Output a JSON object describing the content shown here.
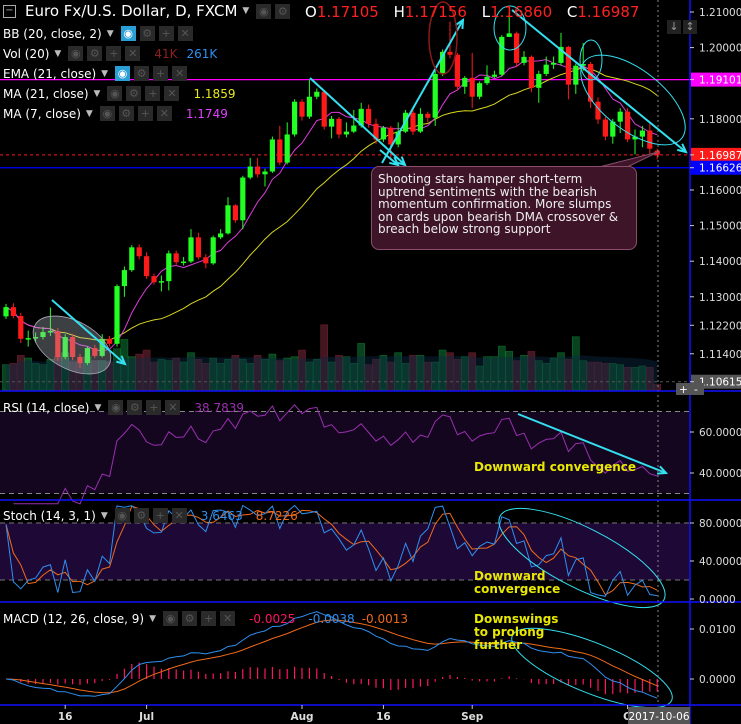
{
  "header": {
    "symbol_title": "Euro Fx/U.S. Dollar, D, FXCM",
    "collapse_icon": "minus-box-icon",
    "ohlc": {
      "o_label": "O",
      "o": "1.17105",
      "h_label": "H",
      "h": "1.17156",
      "l_label": "L",
      "l": "1.16860",
      "c_label": "C",
      "c": "1.16987"
    }
  },
  "legend_buttons": {
    "eye": "◉",
    "gear": "⚙",
    "plus": "+",
    "close": "✕",
    "dropdown": "▼"
  },
  "indicators": {
    "bb": {
      "label": "BB (20, close, 2)"
    },
    "vol": {
      "label": "Vol (20)",
      "value1": "41K",
      "value2": "261K"
    },
    "ema": {
      "label": "EMA (21, close)"
    },
    "ma21": {
      "label": "MA (21, close)",
      "value": "1.1859"
    },
    "ma7": {
      "label": "MA (7, close)",
      "value": "1.1749"
    },
    "rsi": {
      "label": "RSI (14, close)",
      "value": "38.7839"
    },
    "stoch": {
      "label": "Stoch (14, 3, 1)",
      "k": "3.6463",
      "d": "8.7226"
    },
    "macd": {
      "label": "MACD (12, 26, close, 9)",
      "hist": "-0.0025",
      "macd": "-0.0038",
      "signal": "-0.0013"
    }
  },
  "annotations": {
    "callout": "Shooting stars hamper short-term uptrend sentiments with the bearish momentum confirmation. More slumps on cards upon bearish DMA crossover & breach below strong support",
    "rsi_note": "Downward convergence",
    "stoch_note": "Downward convergence",
    "macd_note": "Downswings to prolong further"
  },
  "toolbar": {
    "scale_down": "↓",
    "scale_both": "↕",
    "zoom_in": "+",
    "zoom_out": "-"
  },
  "colors": {
    "up": "#22ff22",
    "down": "#ff1a1a",
    "ma7": "#e03be0",
    "ma21": "#d8d820",
    "rsi": "#9a2fb0",
    "stoch_k": "#2f8ff0",
    "stoch_d": "#f06a1c",
    "macd_hist": "#ff1464",
    "separator": "#1010ff",
    "drawing": "#33e0f0"
  },
  "chart_data": [
    {
      "type": "candlestick",
      "title": "Euro Fx/U.S. Dollar, D, FXCM",
      "open": [
        1.1245,
        1.1271,
        1.1246,
        1.1182,
        1.1184,
        1.1187,
        1.1201,
        1.1204,
        1.1131,
        1.1187,
        1.1131,
        1.1114,
        1.1156,
        1.1134,
        1.1182,
        1.1168,
        1.133,
        1.1375,
        1.1439,
        1.1414,
        1.1358,
        1.1341,
        1.1344,
        1.1422,
        1.1397,
        1.1399,
        1.1467,
        1.1411,
        1.1394,
        1.1467,
        1.1478,
        1.1557,
        1.1515,
        1.1635,
        1.1666,
        1.1644,
        1.1652,
        1.1742,
        1.1677,
        1.1756,
        1.1848,
        1.1806,
        1.1862,
        1.1876,
        1.1778,
        1.18,
        1.1756,
        1.1764,
        1.1781,
        1.1828,
        1.1786,
        1.1742,
        1.1775,
        1.1728,
        1.1764,
        1.1817,
        1.1764,
        1.1814,
        1.1803,
        1.1926,
        1.1988,
        1.198,
        1.189,
        1.1915,
        1.1862,
        1.19,
        1.1918,
        1.1924,
        1.203,
        1.204,
        1.1957,
        1.1974,
        1.1887,
        1.1926,
        1.1952,
        1.1957,
        1.2002,
        1.1896,
        1.1949,
        1.1954,
        1.1848,
        1.1798,
        1.175,
        1.1792,
        1.182,
        1.1742,
        1.175,
        1.1767,
        1.17105
      ],
      "high": [
        1.128,
        1.1282,
        1.1255,
        1.1205,
        1.12,
        1.1215,
        1.127,
        1.1212,
        1.1195,
        1.1196,
        1.114,
        1.116,
        1.1165,
        1.1195,
        1.119,
        1.1335,
        1.1385,
        1.1445,
        1.1447,
        1.1425,
        1.1365,
        1.136,
        1.143,
        1.143,
        1.1412,
        1.149,
        1.148,
        1.142,
        1.1472,
        1.149,
        1.158,
        1.156,
        1.164,
        1.169,
        1.169,
        1.166,
        1.175,
        1.178,
        1.179,
        1.1855,
        1.1855,
        1.191,
        1.1885,
        1.188,
        1.1808,
        1.1805,
        1.179,
        1.1825,
        1.1845,
        1.184,
        1.18,
        1.178,
        1.178,
        1.179,
        1.1825,
        1.1825,
        1.183,
        1.182,
        1.1935,
        1.1995,
        1.2073,
        1.1985,
        1.192,
        1.1985,
        1.1905,
        1.195,
        1.1935,
        1.2035,
        1.2097,
        1.2045,
        1.199,
        1.1978,
        1.1935,
        1.1975,
        1.1975,
        1.2041,
        1.2005,
        1.1955,
        1.2013,
        1.196,
        1.186,
        1.1805,
        1.18,
        1.183,
        1.183,
        1.177,
        1.178,
        1.1785,
        1.17156
      ],
      "low": [
        1.1238,
        1.124,
        1.117,
        1.116,
        1.1172,
        1.118,
        1.119,
        1.112,
        1.1125,
        1.1122,
        1.11,
        1.1108,
        1.1128,
        1.113,
        1.116,
        1.116,
        1.13,
        1.137,
        1.1405,
        1.135,
        1.1335,
        1.1315,
        1.1318,
        1.139,
        1.1388,
        1.1395,
        1.1405,
        1.138,
        1.139,
        1.1462,
        1.1475,
        1.1508,
        1.149,
        1.163,
        1.1635,
        1.161,
        1.1648,
        1.167,
        1.1672,
        1.175,
        1.1795,
        1.18,
        1.1855,
        1.177,
        1.1745,
        1.1745,
        1.1748,
        1.176,
        1.1775,
        1.1775,
        1.173,
        1.1735,
        1.1685,
        1.172,
        1.176,
        1.1755,
        1.176,
        1.179,
        1.178,
        1.192,
        1.197,
        1.188,
        1.187,
        1.183,
        1.1855,
        1.1895,
        1.1915,
        1.192,
        1.203,
        1.1945,
        1.195,
        1.1875,
        1.1845,
        1.192,
        1.194,
        1.195,
        1.1855,
        1.187,
        1.1935,
        1.183,
        1.1785,
        1.174,
        1.173,
        1.176,
        1.1735,
        1.17,
        1.172,
        1.17,
        1.1686
      ],
      "close": [
        1.1271,
        1.1246,
        1.1182,
        1.1184,
        1.1187,
        1.1201,
        1.1204,
        1.1131,
        1.1187,
        1.1131,
        1.1114,
        1.1156,
        1.1134,
        1.1182,
        1.1168,
        1.133,
        1.1375,
        1.1439,
        1.1414,
        1.1358,
        1.1341,
        1.1344,
        1.1422,
        1.1397,
        1.1399,
        1.1467,
        1.1411,
        1.1394,
        1.1467,
        1.1478,
        1.1557,
        1.1515,
        1.1635,
        1.1666,
        1.1644,
        1.1652,
        1.1742,
        1.1677,
        1.1756,
        1.1848,
        1.1806,
        1.1862,
        1.1876,
        1.1778,
        1.18,
        1.1756,
        1.1764,
        1.1781,
        1.1828,
        1.1786,
        1.1742,
        1.1775,
        1.1728,
        1.1764,
        1.1817,
        1.1764,
        1.1814,
        1.1803,
        1.1926,
        1.1988,
        1.198,
        1.189,
        1.1915,
        1.1862,
        1.19,
        1.1918,
        1.1924,
        1.203,
        1.204,
        1.1957,
        1.1974,
        1.1887,
        1.1926,
        1.1952,
        1.1957,
        1.2002,
        1.1896,
        1.1949,
        1.1954,
        1.1848,
        1.1798,
        1.175,
        1.1792,
        1.182,
        1.1742,
        1.175,
        1.1767,
        1.1716,
        1.16987
      ],
      "volume_k": [
        190,
        200,
        260,
        240,
        200,
        190,
        230,
        250,
        280,
        210,
        200,
        250,
        220,
        220,
        210,
        310,
        380,
        250,
        270,
        300,
        210,
        230,
        220,
        240,
        210,
        280,
        230,
        200,
        240,
        200,
        230,
        260,
        230,
        200,
        260,
        230,
        270,
        220,
        240,
        250,
        300,
        210,
        230,
        490,
        210,
        260,
        250,
        200,
        350,
        190,
        230,
        260,
        210,
        280,
        200,
        260,
        260,
        210,
        210,
        300,
        280,
        230,
        250,
        280,
        180,
        250,
        250,
        330,
        290,
        220,
        260,
        290,
        220,
        200,
        240,
        280,
        230,
        400,
        220,
        210,
        210,
        200,
        200,
        190,
        170,
        170,
        180,
        170,
        41
      ],
      "y_axis_ticks": [
        "1.21000",
        "1.20000",
        "1.18000",
        "1.16000",
        "1.15000",
        "1.14000",
        "1.13000",
        "1.12200",
        "1.11400"
      ],
      "price_markers": [
        {
          "label": "1.19101",
          "value": 1.19101,
          "color": "#ff00ff",
          "line": "solid"
        },
        {
          "label": "1.16987",
          "value": 1.16987,
          "color": "#ff1a1a",
          "line": "dotted"
        },
        {
          "label": "1.16626",
          "value": 1.16626,
          "color": "#0000ff",
          "line": "solid"
        },
        {
          "label": "1.10615",
          "value": 1.10615,
          "color": "#555555",
          "line": "dotted"
        }
      ],
      "ylim": [
        1.10615,
        1.21
      ],
      "x_ticks": [
        {
          "label": "16",
          "bar": 8
        },
        {
          "label": "Jul",
          "bar": 19
        },
        {
          "label": "Aug",
          "bar": 40
        },
        {
          "label": "16",
          "bar": 51
        },
        {
          "label": "Sep",
          "bar": 63
        },
        {
          "label": "O",
          "bar": 84
        }
      ],
      "cursor_date": "2017-10-06"
    },
    {
      "type": "line",
      "title": "RSI (14, close)",
      "y_axis_ticks": [
        "60.0000",
        "40.0000"
      ],
      "bands": [
        30,
        70
      ],
      "last": 38.7839
    },
    {
      "type": "line",
      "title": "Stoch (14, 3, 1)",
      "y_axis_ticks": [
        "80.0000",
        "40.0000",
        "0.0000"
      ],
      "bands": [
        20,
        80
      ],
      "last_k": 3.6463,
      "last_d": 8.7226
    },
    {
      "type": "line",
      "title": "MACD (12, 26, close, 9)",
      "y_axis_ticks": [
        "0.0100",
        "0.0000"
      ],
      "last_hist": -0.0025,
      "last_macd": -0.0038,
      "last_signal": -0.0013
    }
  ]
}
